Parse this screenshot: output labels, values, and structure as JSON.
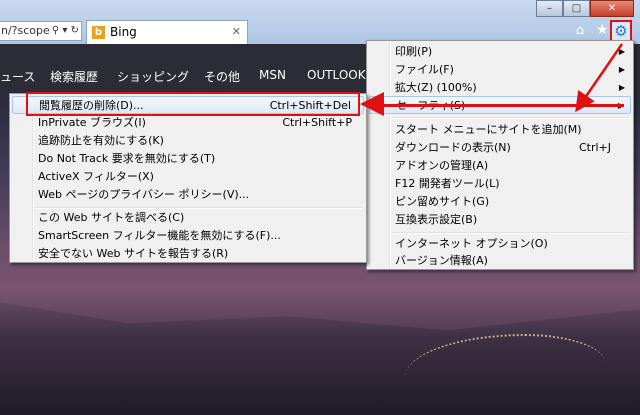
{
  "window": {
    "minimize_glyph": "–",
    "maximize_glyph": "□",
    "close_glyph": "✕"
  },
  "address_bar": {
    "url": "n/?scope",
    "search_glyph": "⚲ ▾ ↻"
  },
  "tab": {
    "title": "Bing",
    "favicon": "b",
    "close_glyph": "✕"
  },
  "toolbar": {
    "home_glyph": "⌂",
    "favorites_glyph": "★",
    "tools_glyph": "⚙"
  },
  "bing_nav": [
    "ュース",
    "検索履歴",
    "ショッピング",
    "その他",
    "MSN",
    "OUTLOOK."
  ],
  "tools_menu": {
    "items": [
      {
        "label": "印刷(P)",
        "shortcut": "",
        "submenu": true
      },
      {
        "label": "ファイル(F)",
        "shortcut": "",
        "submenu": true
      },
      {
        "label": "拡大(Z) (100%)",
        "shortcut": "",
        "submenu": true
      },
      {
        "label": "セーフティ(S)",
        "shortcut": "",
        "submenu": true,
        "highlighted": true
      },
      {
        "label": "スタート メニューにサイトを追加(M)",
        "shortcut": ""
      },
      {
        "label": "ダウンロードの表示(N)",
        "shortcut": "Ctrl+J"
      },
      {
        "label": "アドオンの管理(A)",
        "shortcut": ""
      },
      {
        "label": "F12 開発者ツール(L)",
        "shortcut": ""
      },
      {
        "label": "ピン留めサイト(G)",
        "shortcut": ""
      },
      {
        "label": "互換表示設定(B)",
        "shortcut": ""
      },
      {
        "label": "インターネット オプション(O)",
        "shortcut": ""
      },
      {
        "label": "バージョン情報(A)",
        "shortcut": ""
      }
    ]
  },
  "safety_menu": {
    "items": [
      {
        "label": "閲覧履歴の削除(D)...",
        "shortcut": "Ctrl+Shift+Del",
        "highlighted": true
      },
      {
        "label": "InPrivate ブラウズ(I)",
        "shortcut": "Ctrl+Shift+P"
      },
      {
        "label": "追跡防止を有効にする(K)",
        "shortcut": ""
      },
      {
        "label": "Do Not Track 要求を無効にする(T)",
        "shortcut": ""
      },
      {
        "label": "ActiveX フィルター(X)",
        "shortcut": ""
      },
      {
        "label": "Web ページのプライバシー ポリシー(V)...",
        "shortcut": ""
      },
      {
        "label": "この Web サイトを調べる(C)",
        "shortcut": ""
      },
      {
        "label": "SmartScreen フィルター機能を無効にする(F)...",
        "shortcut": ""
      },
      {
        "label": "安全でない Web サイトを報告する(R)",
        "shortcut": ""
      }
    ]
  },
  "colors": {
    "annotation_red": "#e01010",
    "menu_bg": "#f0f0f0",
    "highlight_border": "#a8c6ea"
  }
}
